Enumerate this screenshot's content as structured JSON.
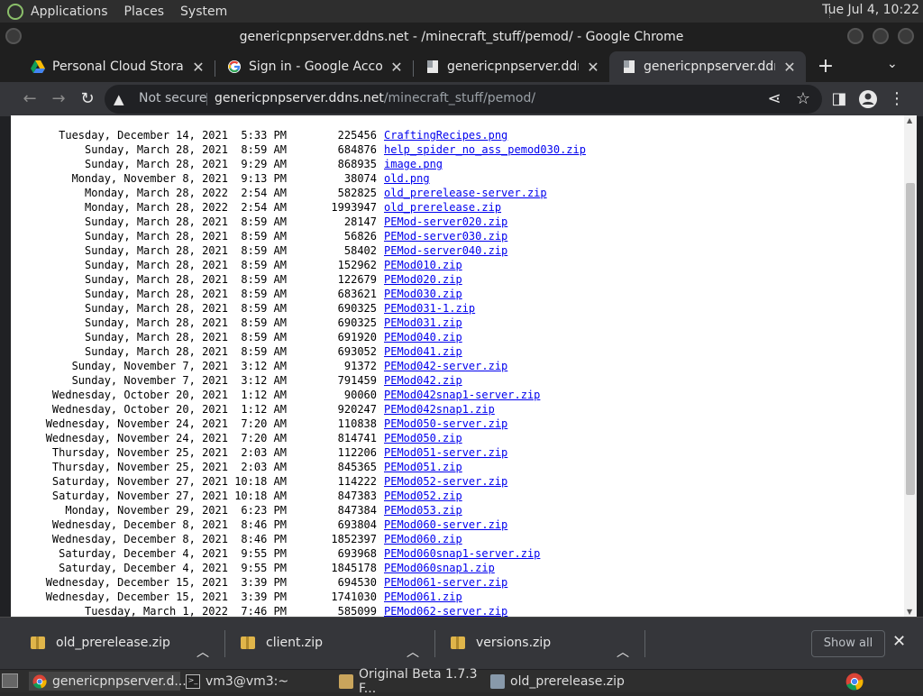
{
  "panel": {
    "menus": [
      "Applications",
      "Places",
      "System"
    ],
    "clock": "Tue Jul  4, 10:22"
  },
  "window": {
    "title": "genericpnpserver.ddns.net - /minecraft_stuff/pemod/ - Google Chrome"
  },
  "tabs": [
    {
      "label": "Personal Cloud Storage & F",
      "icon": "google-drive-icon"
    },
    {
      "label": "Sign in - Google Accounts",
      "icon": "google-g-icon"
    },
    {
      "label": "genericpnpserver.ddns.net",
      "icon": "document-icon"
    },
    {
      "label": "genericpnpserver.ddns.net",
      "icon": "document-icon",
      "active": true
    }
  ],
  "address": {
    "security": "Not secure",
    "host": "genericpnpserver.ddns.net",
    "path": "/minecraft_stuff/pemod/"
  },
  "listing": [
    {
      "date": "Tuesday, December 14, 2021  5:33 PM",
      "size": "225456",
      "name": "CraftingRecipes.png"
    },
    {
      "date": "Sunday, March 28, 2021  8:59 AM",
      "size": "684876",
      "name": "help_spider_no_ass_pemod030.zip"
    },
    {
      "date": "Sunday, March 28, 2021  9:29 AM",
      "size": "868935",
      "name": "image.png"
    },
    {
      "date": "Monday, November 8, 2021  9:13 PM",
      "size": "38074",
      "name": "old.png"
    },
    {
      "date": "Monday, March 28, 2022  2:54 AM",
      "size": "582825",
      "name": "old_prerelease-server.zip"
    },
    {
      "date": "Monday, March 28, 2022  2:54 AM",
      "size": "1993947",
      "name": "old_prerelease.zip"
    },
    {
      "date": "Sunday, March 28, 2021  8:59 AM",
      "size": "28147",
      "name": "PEMod-server020.zip"
    },
    {
      "date": "Sunday, March 28, 2021  8:59 AM",
      "size": "56826",
      "name": "PEMod-server030.zip"
    },
    {
      "date": "Sunday, March 28, 2021  8:59 AM",
      "size": "58402",
      "name": "PEMod-server040.zip"
    },
    {
      "date": "Sunday, March 28, 2021  8:59 AM",
      "size": "152962",
      "name": "PEMod010.zip"
    },
    {
      "date": "Sunday, March 28, 2021  8:59 AM",
      "size": "122679",
      "name": "PEMod020.zip"
    },
    {
      "date": "Sunday, March 28, 2021  8:59 AM",
      "size": "683621",
      "name": "PEMod030.zip"
    },
    {
      "date": "Sunday, March 28, 2021  8:59 AM",
      "size": "690325",
      "name": "PEMod031-1.zip"
    },
    {
      "date": "Sunday, March 28, 2021  8:59 AM",
      "size": "690325",
      "name": "PEMod031.zip"
    },
    {
      "date": "Sunday, March 28, 2021  8:59 AM",
      "size": "691920",
      "name": "PEMod040.zip"
    },
    {
      "date": "Sunday, March 28, 2021  8:59 AM",
      "size": "693052",
      "name": "PEMod041.zip"
    },
    {
      "date": "Sunday, November 7, 2021  3:12 AM",
      "size": "91372",
      "name": "PEMod042-server.zip"
    },
    {
      "date": "Sunday, November 7, 2021  3:12 AM",
      "size": "791459",
      "name": "PEMod042.zip"
    },
    {
      "date": "Wednesday, October 20, 2021  1:12 AM",
      "size": "90060",
      "name": "PEMod042snap1-server.zip"
    },
    {
      "date": "Wednesday, October 20, 2021  1:12 AM",
      "size": "920247",
      "name": "PEMod042snap1.zip"
    },
    {
      "date": "Wednesday, November 24, 2021  7:20 AM",
      "size": "110838",
      "name": "PEMod050-server.zip"
    },
    {
      "date": "Wednesday, November 24, 2021  7:20 AM",
      "size": "814741",
      "name": "PEMod050.zip"
    },
    {
      "date": "Thursday, November 25, 2021  2:03 AM",
      "size": "112206",
      "name": "PEMod051-server.zip"
    },
    {
      "date": "Thursday, November 25, 2021  2:03 AM",
      "size": "845365",
      "name": "PEMod051.zip"
    },
    {
      "date": "Saturday, November 27, 2021 10:18 AM",
      "size": "114222",
      "name": "PEMod052-server.zip"
    },
    {
      "date": "Saturday, November 27, 2021 10:18 AM",
      "size": "847383",
      "name": "PEMod052.zip"
    },
    {
      "date": "Monday, November 29, 2021  6:23 PM",
      "size": "847384",
      "name": "PEMod053.zip"
    },
    {
      "date": "Wednesday, December 8, 2021  8:46 PM",
      "size": "693804",
      "name": "PEMod060-server.zip"
    },
    {
      "date": "Wednesday, December 8, 2021  8:46 PM",
      "size": "1852397",
      "name": "PEMod060.zip"
    },
    {
      "date": "Saturday, December 4, 2021  9:55 PM",
      "size": "693968",
      "name": "PEMod060snap1-server.zip"
    },
    {
      "date": "Saturday, December 4, 2021  9:55 PM",
      "size": "1845178",
      "name": "PEMod060snap1.zip"
    },
    {
      "date": "Wednesday, December 15, 2021  3:39 PM",
      "size": "694530",
      "name": "PEMod061-server.zip"
    },
    {
      "date": "Wednesday, December 15, 2021  3:39 PM",
      "size": "1741030",
      "name": "PEMod061.zip"
    },
    {
      "date": "Tuesday, March 1, 2022  7:46 PM",
      "size": "585099",
      "name": "PEMod062-server.zip"
    }
  ],
  "downloads": [
    {
      "name": "old_prerelease.zip"
    },
    {
      "name": "client.zip"
    },
    {
      "name": "versions.zip"
    }
  ],
  "shelf": {
    "show_all": "Show all"
  },
  "taskbar": [
    {
      "label": "genericpnpserver.d...",
      "icon": "chrome-icon",
      "active": true
    },
    {
      "label": "vm3@vm3:~",
      "icon": "terminal-icon"
    },
    {
      "label": "Original Beta 1.7.3 F...",
      "icon": "folder-icon"
    },
    {
      "label": "old_prerelease.zip",
      "icon": "archive-icon"
    }
  ]
}
